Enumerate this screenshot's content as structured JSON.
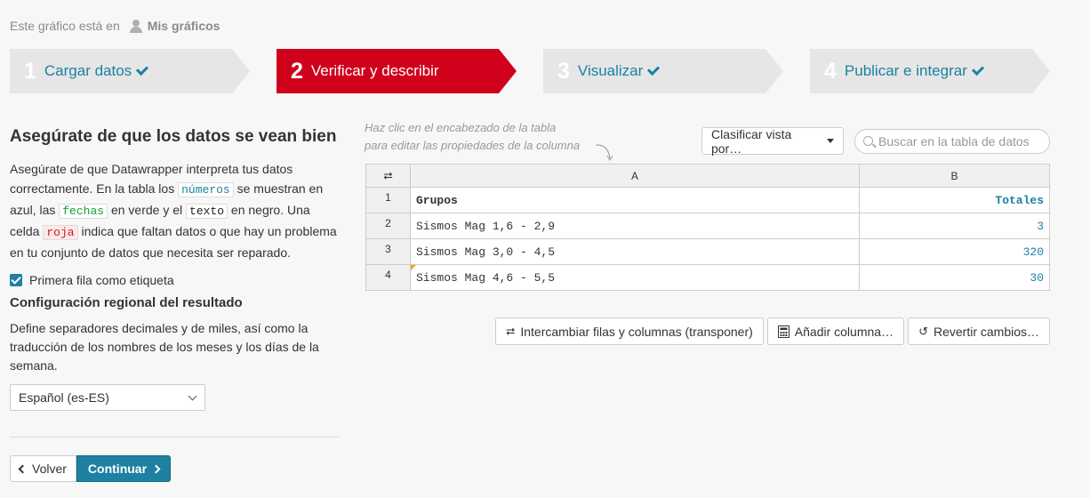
{
  "owner": {
    "prefix": "Este gráfico está en",
    "folder": "Mis gráficos"
  },
  "steps": [
    {
      "num": "1",
      "label": "Cargar datos",
      "done": true,
      "active": false
    },
    {
      "num": "2",
      "label": "Verificar y describir",
      "done": false,
      "active": true
    },
    {
      "num": "3",
      "label": "Visualizar",
      "done": true,
      "active": false
    },
    {
      "num": "4",
      "label": "Publicar e integrar",
      "done": true,
      "active": false
    }
  ],
  "left": {
    "title": "Asegúrate de que los datos se vean bien",
    "desc_1": "Asegúrate de que Datawrapper interpreta tus datos correctamente. En la tabla los",
    "code_numbers": "números",
    "desc_2": "se muestran en azul, las",
    "code_dates": "fechas",
    "desc_3": "en verde y el",
    "code_text": "texto",
    "desc_4": "en negro. Una celda",
    "code_red": "roja",
    "desc_5": "indica que faltan datos o que hay un problema en tu conjunto de datos que necesita ser reparado.",
    "checkbox_label": "Primera fila como etiqueta",
    "locale_title": "Configuración regional del resultado",
    "locale_desc": "Define separadores decimales y de miles, así como la traducción de los nombres de los meses y los días de la semana.",
    "locale_value": "Español (es-ES)",
    "back_label": "Volver",
    "continue_label": "Continuar"
  },
  "right": {
    "hint_line1": "Haz clic en el encabezado de la tabla",
    "hint_line2": "para editar las propiedades de la columna",
    "sort_label": "Clasificar vista por…",
    "search_placeholder": "Buscar en la tabla de datos",
    "table": {
      "col_a": "A",
      "col_b": "B",
      "rows": [
        {
          "n": "1",
          "a": "Grupos",
          "b": "Totales"
        },
        {
          "n": "2",
          "a": "Sismos Mag 1,6 - 2,9",
          "b": "3"
        },
        {
          "n": "3",
          "a": "Sismos Mag 3,0 - 4,5",
          "b": "320"
        },
        {
          "n": "4",
          "a": "Sismos Mag 4,6 - 5,5",
          "b": "30"
        }
      ]
    },
    "transpose_label": "Intercambiar filas y columnas (transponer)",
    "add_column_label": "Añadir columna…",
    "revert_label": "Revertir cambios…"
  },
  "colors": {
    "accent": "#1d81a2",
    "active_step": "#d0021b",
    "warning": "#f5a623"
  }
}
